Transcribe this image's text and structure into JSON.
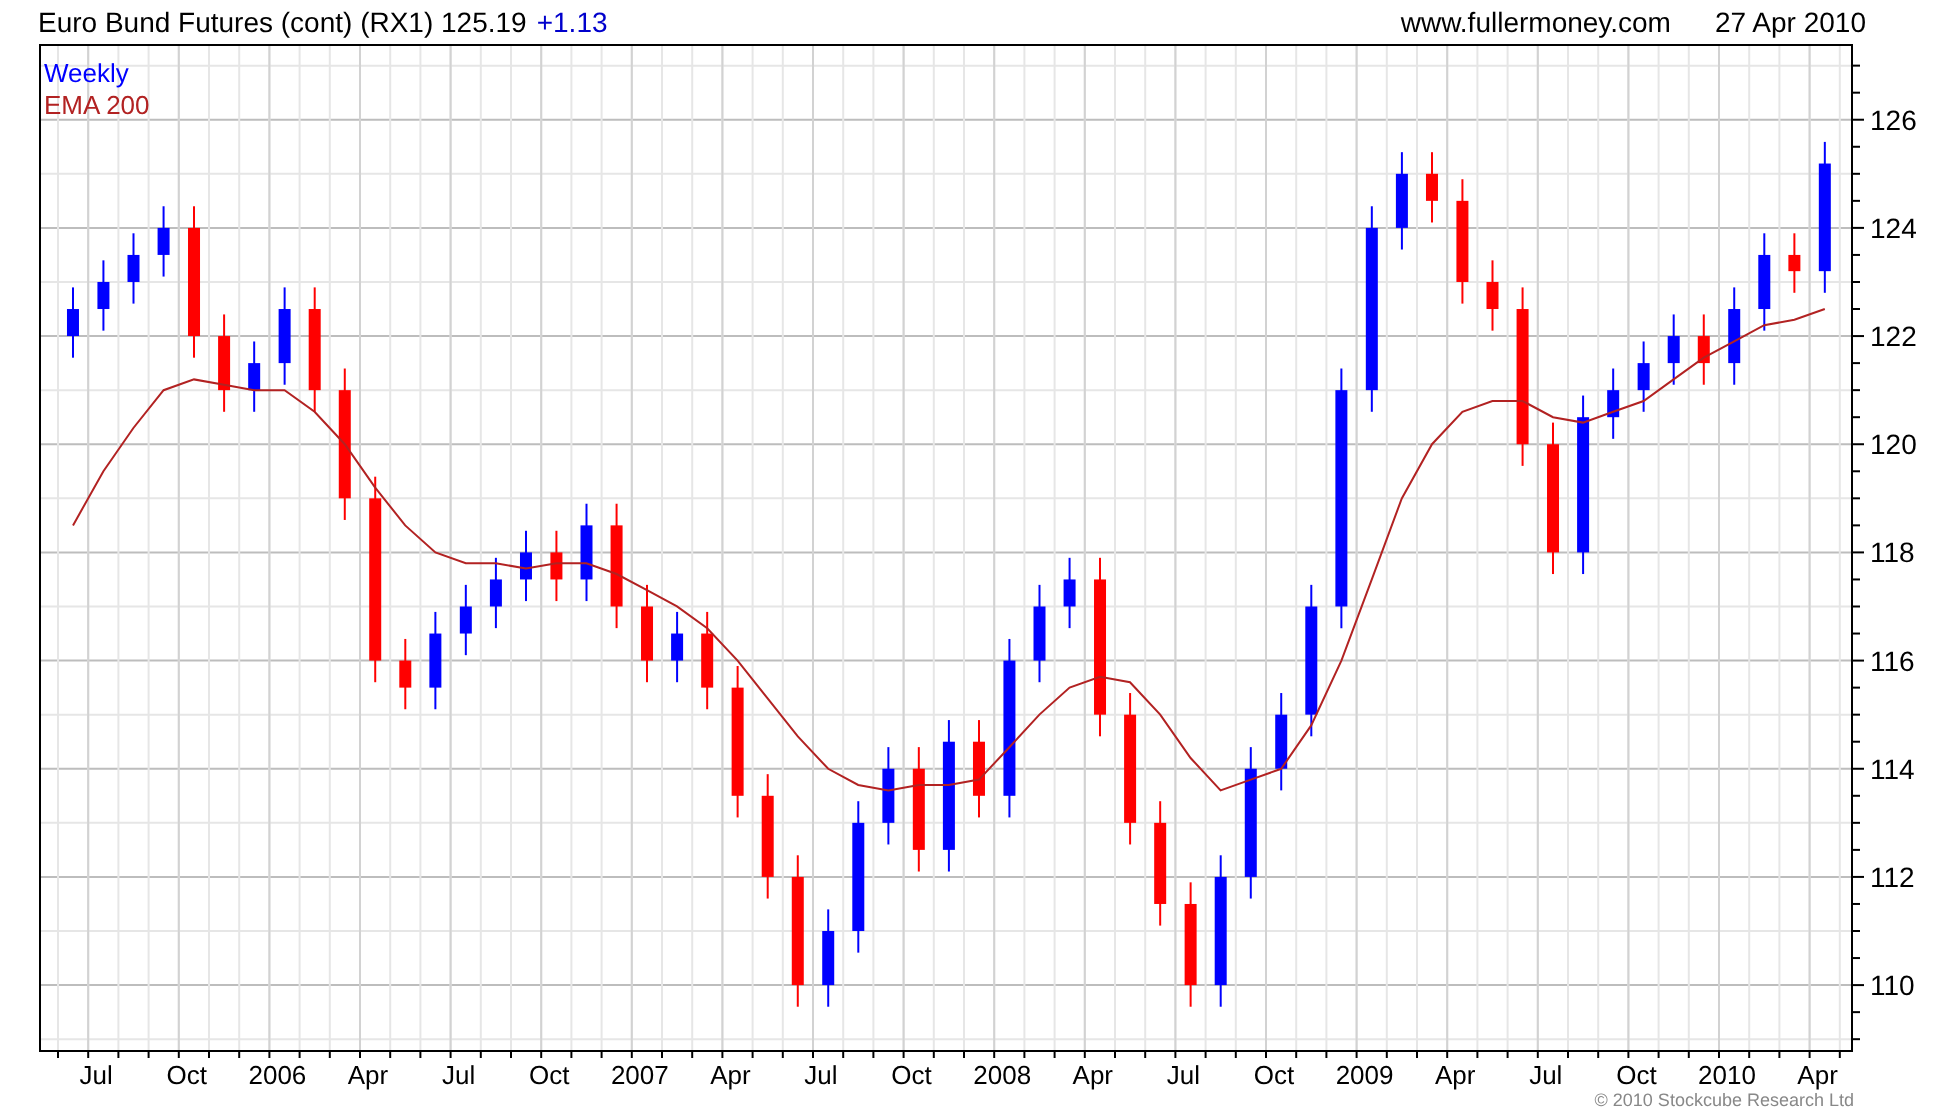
{
  "header": {
    "title": "Euro Bund Futures (cont) (RX1) 125.19",
    "change": "+1.13",
    "source": "www.fullermoney.com",
    "date": "27 Apr 2010"
  },
  "chart": {
    "legend": {
      "label": "Weekly",
      "color": "#0000ff"
    },
    "chart_data": {
      "type": "candlestick",
      "grid": true,
      "x": [
        2005.458,
        2005.542,
        2005.625,
        2005.708,
        2005.792,
        2005.875,
        2005.958,
        2006.042,
        2006.125,
        2006.208,
        2006.292,
        2006.375,
        2006.458,
        2006.542,
        2006.625,
        2006.708,
        2006.792,
        2006.875,
        2006.958,
        2007.042,
        2007.125,
        2007.208,
        2007.292,
        2007.375,
        2007.458,
        2007.542,
        2007.625,
        2007.708,
        2007.792,
        2007.875,
        2007.958,
        2008.042,
        2008.125,
        2008.208,
        2008.292,
        2008.375,
        2008.458,
        2008.542,
        2008.625,
        2008.708,
        2008.792,
        2008.875,
        2008.958,
        2009.042,
        2009.125,
        2009.208,
        2009.292,
        2009.375,
        2009.458,
        2009.542,
        2009.625,
        2009.708,
        2009.792,
        2009.875,
        2009.958,
        2010.042,
        2010.125,
        2010.208,
        2010.292
      ],
      "ohlc": [
        [
          122,
          122.9,
          121.6,
          122.5
        ],
        [
          122.5,
          123.4,
          122.1,
          123
        ],
        [
          123,
          123.9,
          122.6,
          123.5
        ],
        [
          123.5,
          124.4,
          123.1,
          124
        ],
        [
          124,
          124.4,
          121.6,
          122
        ],
        [
          122,
          122.4,
          120.6,
          121
        ],
        [
          121,
          121.9,
          120.6,
          121.5
        ],
        [
          121.5,
          122.9,
          121.1,
          122.5
        ],
        [
          122.5,
          122.9,
          120.6,
          121
        ],
        [
          121,
          121.4,
          118.6,
          119
        ],
        [
          119,
          119.4,
          115.6,
          116
        ],
        [
          116,
          116.4,
          115.1,
          115.5
        ],
        [
          115.5,
          116.9,
          115.1,
          116.5
        ],
        [
          116.5,
          117.4,
          116.1,
          117
        ],
        [
          117,
          117.9,
          116.6,
          117.5
        ],
        [
          117.5,
          118.4,
          117.1,
          118
        ],
        [
          118,
          118.4,
          117.1,
          117.5
        ],
        [
          117.5,
          118.9,
          117.1,
          118.5
        ],
        [
          118.5,
          118.9,
          116.6,
          117
        ],
        [
          117,
          117.4,
          115.6,
          116
        ],
        [
          116,
          116.9,
          115.6,
          116.5
        ],
        [
          116.5,
          116.9,
          115.1,
          115.5
        ],
        [
          115.5,
          115.9,
          113.1,
          113.5
        ],
        [
          113.5,
          113.9,
          111.6,
          112
        ],
        [
          112,
          112.4,
          109.6,
          110
        ],
        [
          110,
          111.4,
          109.6,
          111
        ],
        [
          111,
          113.4,
          110.6,
          113
        ],
        [
          113,
          114.4,
          112.6,
          114
        ],
        [
          114,
          114.4,
          112.1,
          112.5
        ],
        [
          112.5,
          114.9,
          112.1,
          114.5
        ],
        [
          114.5,
          114.9,
          113.1,
          113.5
        ],
        [
          113.5,
          116.4,
          113.1,
          116
        ],
        [
          116,
          117.4,
          115.6,
          117
        ],
        [
          117,
          117.9,
          116.6,
          117.5
        ],
        [
          117.5,
          117.9,
          114.6,
          115
        ],
        [
          115,
          115.4,
          112.6,
          113
        ],
        [
          113,
          113.4,
          111.1,
          111.5
        ],
        [
          111.5,
          111.9,
          109.6,
          110
        ],
        [
          110,
          112.4,
          109.6,
          112
        ],
        [
          112,
          114.4,
          111.6,
          114
        ],
        [
          114,
          115.4,
          113.6,
          115
        ],
        [
          115,
          117.4,
          114.6,
          117
        ],
        [
          117,
          121.4,
          116.6,
          121
        ],
        [
          121,
          124.4,
          120.6,
          124
        ],
        [
          124,
          125.4,
          123.6,
          125
        ],
        [
          125,
          125.4,
          124.1,
          124.5
        ],
        [
          124.5,
          124.9,
          122.6,
          123
        ],
        [
          123,
          123.4,
          122.1,
          122.5
        ],
        [
          122.5,
          122.9,
          119.6,
          120
        ],
        [
          120,
          120.4,
          117.6,
          118
        ],
        [
          118,
          120.9,
          117.6,
          120.5
        ],
        [
          120.5,
          121.4,
          120.1,
          121
        ],
        [
          121,
          121.9,
          120.6,
          121.5
        ],
        [
          121.5,
          122.4,
          121.1,
          122
        ],
        [
          122,
          122.4,
          121.1,
          121.5
        ],
        [
          121.5,
          122.9,
          121.1,
          122.5
        ],
        [
          122.5,
          123.9,
          122.1,
          123.5
        ],
        [
          123.5,
          123.9,
          122.8,
          123.2
        ],
        [
          123.2,
          125.59,
          122.8,
          125.19
        ]
      ],
      "series": [
        {
          "name": "EMA 200",
          "type": "line",
          "color": "#b22222",
          "values": [
            118.5,
            119.5,
            120.3,
            121,
            121.2,
            121.1,
            121,
            121,
            120.6,
            120,
            119.2,
            118.5,
            118,
            117.8,
            117.8,
            117.7,
            117.8,
            117.8,
            117.6,
            117.3,
            117,
            116.6,
            116,
            115.3,
            114.6,
            114,
            113.7,
            113.6,
            113.7,
            113.7,
            113.8,
            114.4,
            115,
            115.5,
            115.7,
            115.6,
            115,
            114.2,
            113.6,
            113.8,
            114,
            114.8,
            116,
            117.5,
            119,
            120,
            120.6,
            120.8,
            120.8,
            120.5,
            120.4,
            120.6,
            120.8,
            121.2,
            121.6,
            121.9,
            122.2,
            122.3,
            122.5
          ]
        }
      ],
      "xlim": [
        2005.367,
        2010.367
      ],
      "ylim": [
        108.8,
        127.4
      ],
      "xticks": [
        {
          "value": 2005.5,
          "label": "Jul"
        },
        {
          "value": 2005.75,
          "label": "Oct"
        },
        {
          "value": 2006,
          "label": "2006"
        },
        {
          "value": 2006.25,
          "label": "Apr"
        },
        {
          "value": 2006.5,
          "label": "Jul"
        },
        {
          "value": 2006.75,
          "label": "Oct"
        },
        {
          "value": 2007,
          "label": "2007"
        },
        {
          "value": 2007.25,
          "label": "Apr"
        },
        {
          "value": 2007.5,
          "label": "Jul"
        },
        {
          "value": 2007.75,
          "label": "Oct"
        },
        {
          "value": 2008,
          "label": "2008"
        },
        {
          "value": 2008.25,
          "label": "Apr"
        },
        {
          "value": 2008.5,
          "label": "Jul"
        },
        {
          "value": 2008.75,
          "label": "Oct"
        },
        {
          "value": 2009,
          "label": "2009"
        },
        {
          "value": 2009.25,
          "label": "Apr"
        },
        {
          "value": 2009.5,
          "label": "Jul"
        },
        {
          "value": 2009.75,
          "label": "Oct"
        },
        {
          "value": 2010,
          "label": "2010"
        },
        {
          "value": 2010.25,
          "label": "Apr"
        }
      ],
      "yticks": [
        110,
        112,
        114,
        116,
        118,
        120,
        122,
        124,
        126
      ]
    }
  },
  "footer": {
    "copyright": "© 2010 Stockcube Research Ltd"
  }
}
